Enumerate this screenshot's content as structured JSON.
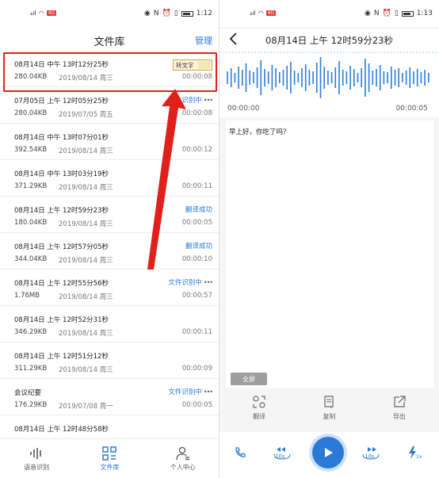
{
  "status_left": {
    "carrier_badge": "4G",
    "time": "1:12"
  },
  "status_right": {
    "carrier_badge": "4G",
    "time": "1:13"
  },
  "library": {
    "title": "文件库",
    "manage_label": "管理",
    "convert_label": "转文字",
    "files": [
      {
        "name": "08月14日 中午 13时12分25秒",
        "size": "280.04KB",
        "date": "2019/08/14 周三",
        "duration": "00:00:08",
        "status": "",
        "action": "convert"
      },
      {
        "name": "07月05日 上午 12时05分25秒",
        "size": "280.04KB",
        "date": "2019/07/05 周五",
        "duration": "00:00:08",
        "status": "文件识别中",
        "dots": true
      },
      {
        "name": "08月14日 中午 13时07分01秒",
        "size": "392.54KB",
        "date": "2019/08/14 周三",
        "duration": "00:00:12",
        "status": ""
      },
      {
        "name": "08月14日 中午 13时03分19秒",
        "size": "371.29KB",
        "date": "2019/08/14 周三",
        "duration": "00:00:11",
        "status": ""
      },
      {
        "name": "08月14日 上午 12时59分23秒",
        "size": "180.04KB",
        "date": "2019/08/14 周三",
        "duration": "00:00:05",
        "status": "翻译成功"
      },
      {
        "name": "08月14日 上午 12时57分05秒",
        "size": "344.04KB",
        "date": "2019/08/14 周三",
        "duration": "00:00:10",
        "status": "翻译成功"
      },
      {
        "name": "08月14日 上午 12时55分56秒",
        "size": "1.76MB",
        "date": "2019/08/14 周三",
        "duration": "00:00:57",
        "status": "文件识别中",
        "dots": true
      },
      {
        "name": "08月14日 上午 12时52分31秒",
        "size": "346.29KB",
        "date": "2019/08/14 周三",
        "duration": "00:00:11",
        "status": ""
      },
      {
        "name": "08月14日 上午 12时51分12秒",
        "size": "311.29KB",
        "date": "2019/08/14 周三",
        "duration": "00:00:09",
        "status": ""
      },
      {
        "name": "会议纪要",
        "size": "176.29KB",
        "date": "2019/07/08 周一",
        "duration": "00:00:05",
        "status": "文件识别中",
        "dots": true
      },
      {
        "name": "08月14日 上午 12时48分58秒",
        "size": "",
        "date": "",
        "duration": "",
        "status": ""
      }
    ]
  },
  "bottom_nav": [
    {
      "label": "语音识别",
      "icon": "waveform-icon",
      "active": false
    },
    {
      "label": "文件库",
      "icon": "grid-icon",
      "active": true
    },
    {
      "label": "个人中心",
      "icon": "person-icon",
      "active": false
    }
  ],
  "detail": {
    "title": "08月14日 上午 12时59分23秒",
    "time_start": "00:00:00",
    "time_end": "00:00:05",
    "transcript": "早上好，你吃了吗？",
    "fullscreen_label": "全屏",
    "actions": [
      {
        "label": "翻译",
        "icon": "translate-icon"
      },
      {
        "label": "复制",
        "icon": "copy-icon"
      },
      {
        "label": "导出",
        "icon": "export-icon"
      }
    ],
    "rewind_label": "10s",
    "forward_label": "10s",
    "speed_label": "1x"
  },
  "colors": {
    "accent": "#2b7bd6",
    "highlight": "#e0201a",
    "text": "#222222"
  }
}
